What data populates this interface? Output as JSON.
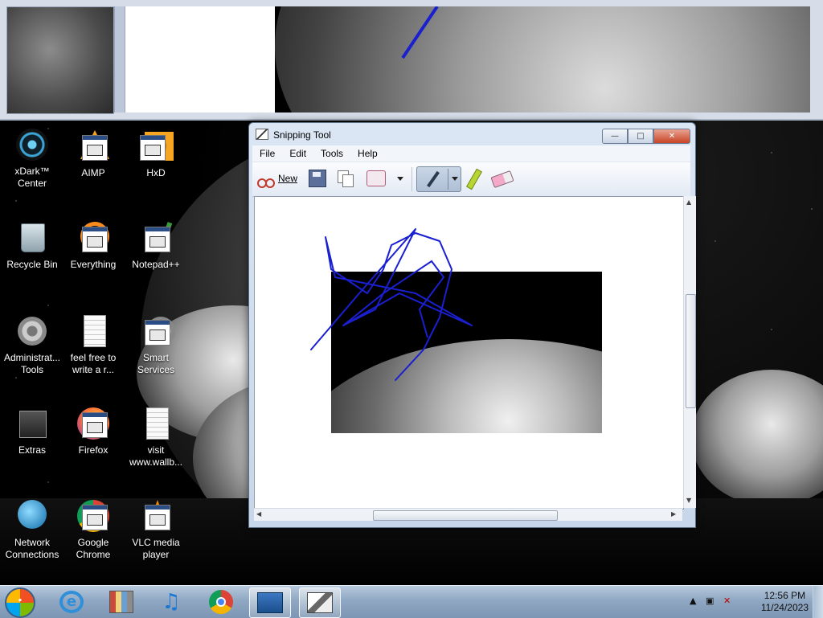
{
  "desktop_icons": {
    "xdark": "xDark™ Center",
    "aimp": "AIMP",
    "hxd": "HxD",
    "recycle_bin": "Recycle Bin",
    "everything": "Everything",
    "notepadpp": "Notepad++",
    "admin_tools": "Administrat... Tools",
    "feel_free": "feel free to write a r...",
    "smart_services": "Smart Services",
    "extras": "Extras",
    "firefox": "Firefox",
    "visit": "visit www.wallb...",
    "network": "Network Connections",
    "chrome": "Google Chrome",
    "vlc": "VLC media player"
  },
  "window": {
    "title": "Snipping Tool",
    "menu": [
      "File",
      "Edit",
      "Tools",
      "Help"
    ],
    "toolbar": {
      "new_label": "New"
    }
  },
  "taskbar": {
    "time": "12:56 PM",
    "date": "11/24/2023"
  },
  "colors": {
    "ink": "#1a1fd0",
    "taskbar": "#8fa7c2",
    "close_button": "#c84325"
  }
}
